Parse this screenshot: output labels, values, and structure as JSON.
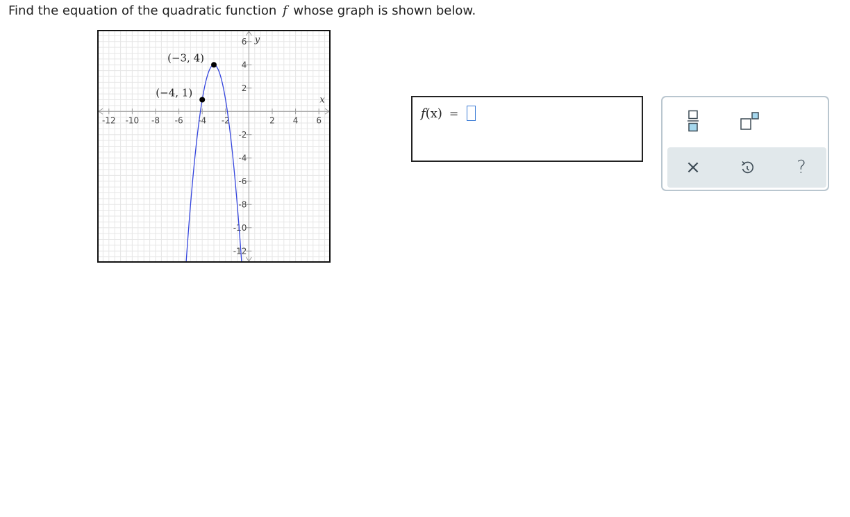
{
  "question": {
    "prefix": "Find the equation of the quadratic function",
    "function_name": "f",
    "suffix": "whose graph is shown below."
  },
  "graph": {
    "x_axis_label": "x",
    "y_axis_label": "y",
    "x_tick_labels": [
      "-12",
      "-10",
      "-8",
      "-6",
      "-4",
      "-2",
      "2",
      "4",
      "6"
    ],
    "y_tick_labels": [
      "6",
      "4",
      "2",
      "-2",
      "-4",
      "-6",
      "-8",
      "-10",
      "-12"
    ],
    "x_range": [
      -13,
      7
    ],
    "y_range": [
      -13,
      7
    ],
    "grid": true,
    "curve_color": "#3344dd",
    "points": [
      {
        "label": "(−3, 4)",
        "x": -3,
        "y": 4
      },
      {
        "label": "(−4, 1)",
        "x": -4,
        "y": 1
      }
    ],
    "parabola": {
      "vertex_x": -3,
      "vertex_y": 4,
      "a": -3
    }
  },
  "answer": {
    "function_prefix": "f",
    "argument": "(x)",
    "equals": "=",
    "value": ""
  },
  "toolbar": {
    "fraction_button": "fraction-icon",
    "exponent_button": "exponent-icon",
    "clear_button": "×",
    "undo_button": "undo-icon",
    "help_button": "?",
    "accent_color": "#3a9bc8"
  }
}
